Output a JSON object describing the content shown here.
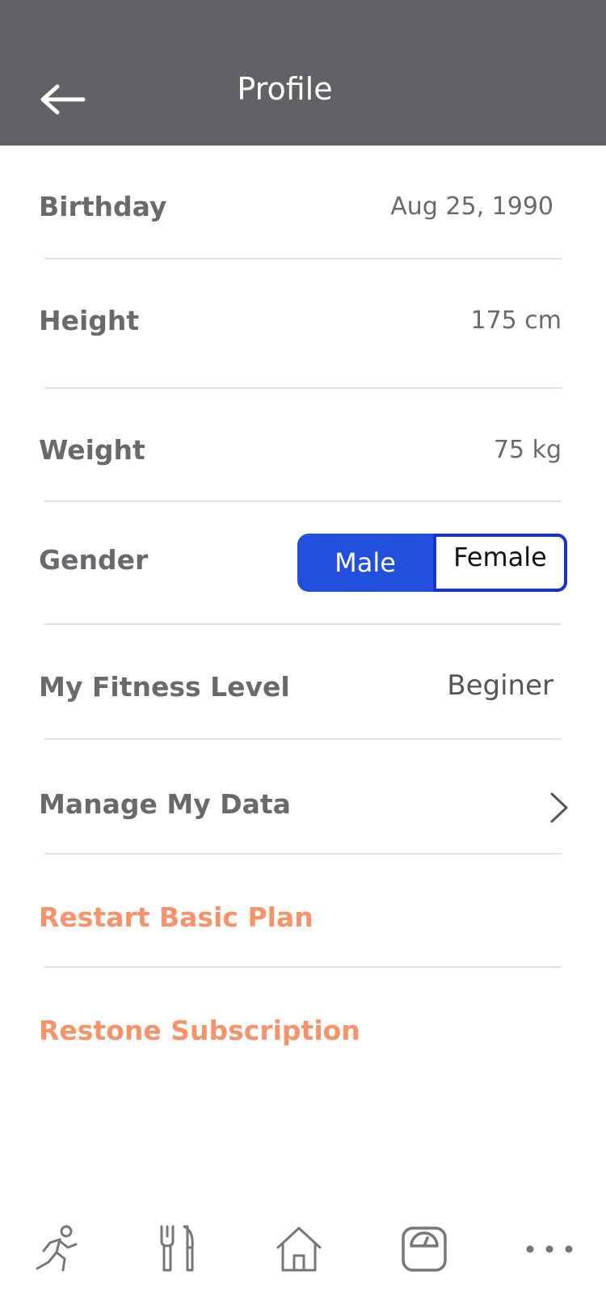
{
  "header": {
    "title": "Profile",
    "back_icon": "arrow-left-icon"
  },
  "rows": {
    "birthday": {
      "label": "Birthday",
      "value": "Aug 25, 1990"
    },
    "height": {
      "label": "Height",
      "value": "175 cm"
    },
    "weight": {
      "label": "Weight",
      "value": "75 kg"
    },
    "gender": {
      "label": "Gender",
      "options": [
        "Male",
        "Female"
      ],
      "selected": "Male"
    },
    "fitness": {
      "label": "My Fitness Level",
      "value": "Beginer"
    },
    "manage": {
      "label": "Manage My Data"
    },
    "restart": {
      "label": "Restart Basic Plan"
    },
    "restore": {
      "label": "Restone Subscription"
    }
  },
  "tabbar": {
    "items": [
      "running-person-icon",
      "fork-knife-icon",
      "home-icon",
      "scale-icon",
      "more-dots-icon"
    ]
  },
  "colors": {
    "header_bg": "#616265",
    "accent": "#2250dd",
    "accent_border": "#1c33c8",
    "orange": "#f5936b",
    "text": "#6a6a6e"
  }
}
